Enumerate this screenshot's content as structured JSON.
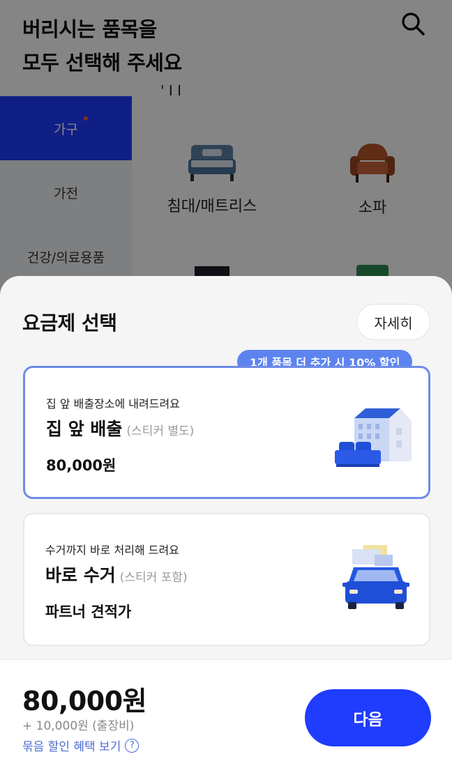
{
  "header": {
    "title_line1": "버리시는 품목을",
    "title_line2": "모두 선택해 주세요",
    "search_icon": "search-icon"
  },
  "sidebar": {
    "items": [
      {
        "label": "가구",
        "active": true,
        "has_dot": true
      },
      {
        "label": "가전",
        "active": false
      },
      {
        "label": "건강/의료용품",
        "active": false
      }
    ]
  },
  "categories": {
    "partial_label": "' I I",
    "items": [
      {
        "label": "침대/매트리스",
        "icon": "bed-icon"
      },
      {
        "label": "소파",
        "icon": "armchair-icon"
      }
    ]
  },
  "sheet": {
    "title": "요금제 선택",
    "detail_button": "자세히",
    "plans": [
      {
        "subtitle": "집 앞 배출장소에 내려드려요",
        "name": "집 앞 배출",
        "note": "(스티커 별도)",
        "price": "80,000원",
        "selected": true,
        "promo": "1개 품목 더 추가 시 10% 할인",
        "icon": "house-sofa-icon"
      },
      {
        "subtitle": "수거까지 바로 처리해 드려요",
        "name": "바로 수거",
        "note": "(스티커 포함)",
        "price": "파트너 견적가",
        "selected": false,
        "icon": "truck-icon"
      }
    ]
  },
  "footer": {
    "total": "80,000원",
    "fee": "+ 10,000원 (출장비)",
    "bundle_link": "묶음 할인 혜택 보기",
    "help_icon_glyph": "?",
    "next_button": "다음"
  },
  "colors": {
    "accent": "#1f3cff",
    "promo": "#5d84ee",
    "selected_border": "#6e8be8",
    "link": "#4b6bd6"
  }
}
